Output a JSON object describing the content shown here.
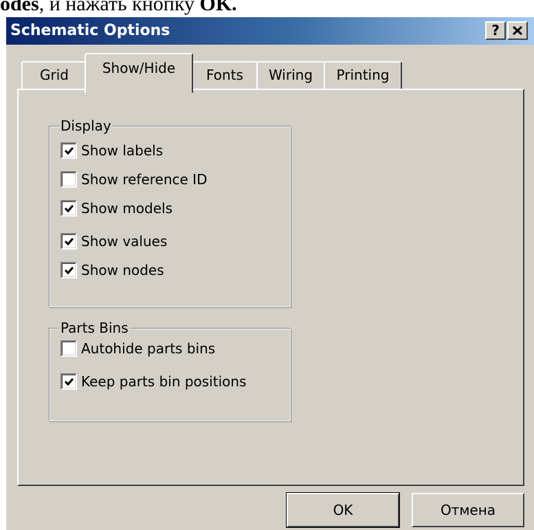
{
  "document_text": {
    "part_bold": "odes",
    "part_normal": ", и нажать кнопку ",
    "part_bold_end": "OK."
  },
  "dialog": {
    "title": "Schematic Options",
    "help_button": "?",
    "close_icon": "close-icon"
  },
  "tabs": [
    {
      "label": "Grid",
      "active": false
    },
    {
      "label": "Show/Hide",
      "active": true
    },
    {
      "label": "Fonts",
      "active": false
    },
    {
      "label": "Wiring",
      "active": false
    },
    {
      "label": "Printing",
      "active": false
    }
  ],
  "display_group": {
    "legend": "Display",
    "items": [
      {
        "label": "Show labels",
        "checked": true
      },
      {
        "label": "Show reference ID",
        "checked": false
      },
      {
        "label": "Show models",
        "checked": true
      },
      {
        "label": "Show values",
        "checked": true
      },
      {
        "label": "Show nodes",
        "checked": true
      }
    ]
  },
  "parts_bins_group": {
    "legend": "Parts Bins",
    "items": [
      {
        "label": "Autohide parts bins",
        "checked": false
      },
      {
        "label": "Keep parts bin positions",
        "checked": true
      }
    ]
  },
  "buttons": {
    "ok": "OK",
    "cancel": "Отмена"
  },
  "colors": {
    "face": "#d4d0c8",
    "title_start": "#0a246a",
    "title_end": "#a6caf0"
  }
}
